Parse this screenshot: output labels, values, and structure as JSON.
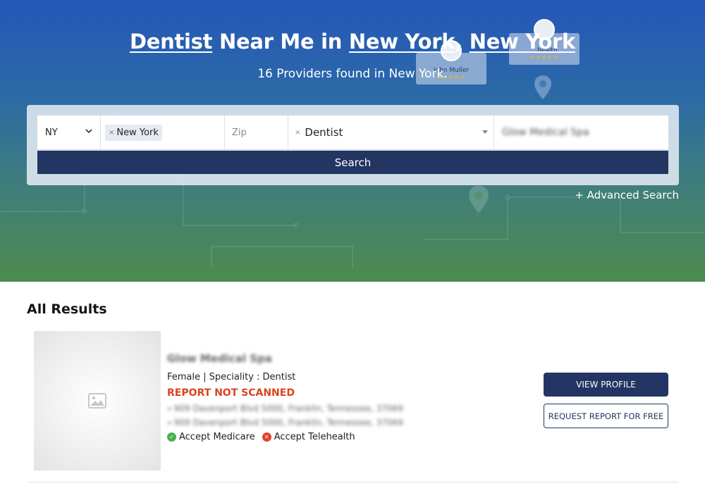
{
  "hero": {
    "title_link1": "Dentist",
    "title_mid": " Near Me in ",
    "title_link2": "New York",
    "title_comma": ", ",
    "title_link3": "New York",
    "subtitle": "16 Providers found in New York.",
    "float_cards": [
      {
        "name": "John Muller",
        "stars": "★★★★★"
      },
      {
        "name": "...health",
        "stars": "★★★★★"
      }
    ]
  },
  "search": {
    "state_value": "NY",
    "city_tag": "New York",
    "zip_placeholder": "Zip",
    "speciality_value": "Dentist",
    "provider_value": "Glow Medical Spa",
    "search_button": "Search",
    "advanced_link": "+ Advanced Search"
  },
  "results": {
    "title": "All Results",
    "items": [
      {
        "name": "Glow Medical Spa",
        "meta": "Female | Speciality : Dentist",
        "report_status": "REPORT NOT SCANNED",
        "address1": "909 Davenport Blvd 5000, Franklin, Tennessee, 37069",
        "address2": "909 Davenport Blvd 5000, Franklin, Tennessee, 37069",
        "accept_medicare": "Accept Medicare",
        "accept_telehealth": "Accept Telehealth",
        "view_profile": "VIEW PROFILE",
        "request_report": "REQUEST REPORT FOR FREE"
      }
    ]
  },
  "colors": {
    "primary": "#233562",
    "report_red": "#d94322",
    "check_green": "#4caf50",
    "cross_red": "#e0442c"
  }
}
